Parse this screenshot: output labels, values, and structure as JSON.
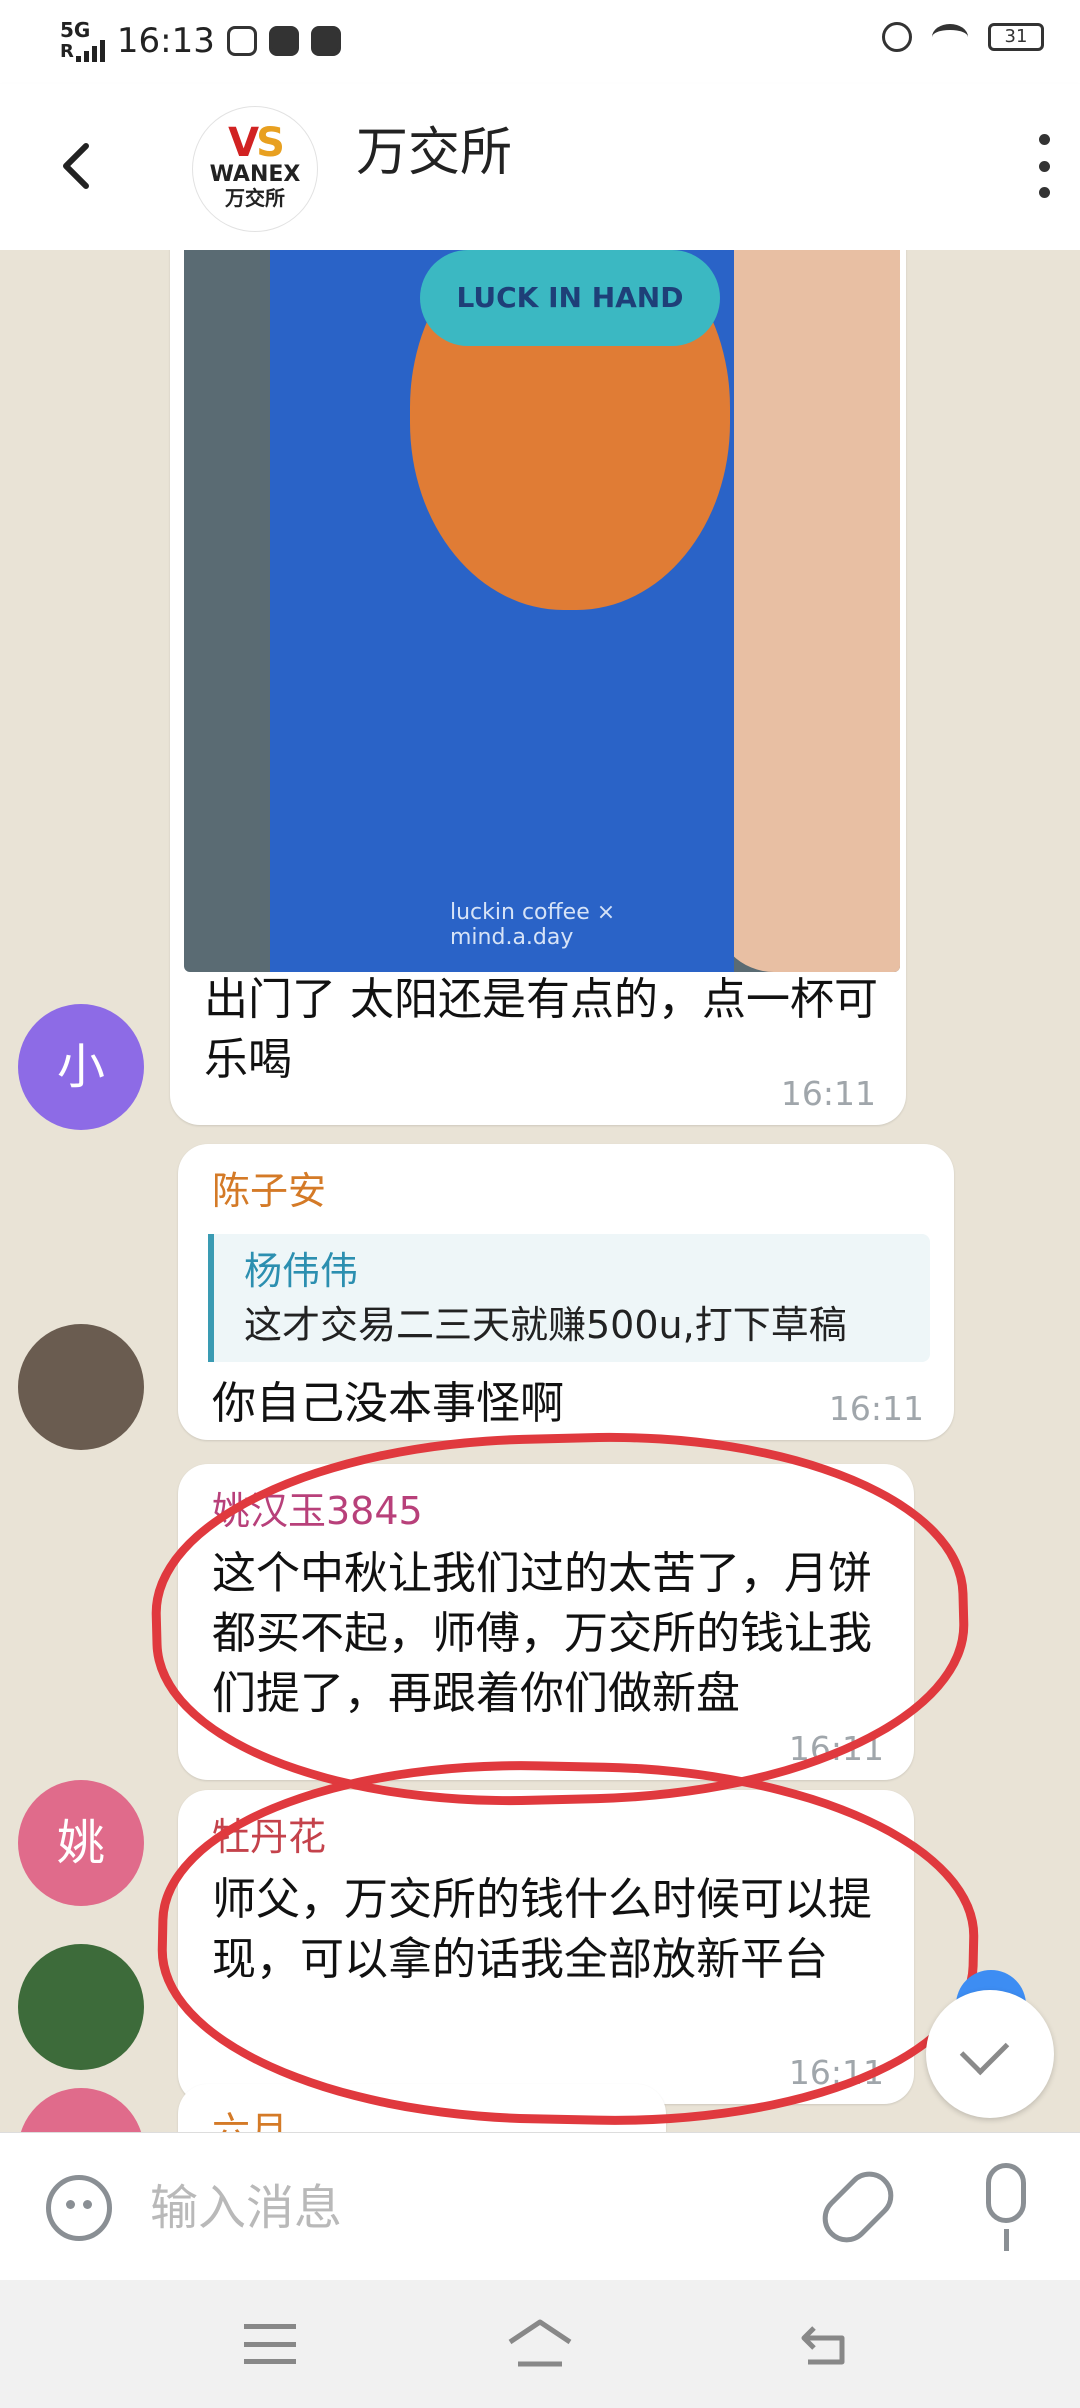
{
  "status_bar": {
    "network_label": "5G",
    "roaming": "R",
    "time": "16:13",
    "battery": "31"
  },
  "header": {
    "title": "万交所",
    "avatar": {
      "brand": "WANEX",
      "brand_cn": "万交所",
      "mark_v": "V",
      "mark_s": "S"
    }
  },
  "messages": [
    {
      "avatar_initial": "小",
      "image_caption": "luckin coffee × mind.a.day",
      "cap_text": "LUCK IN HAND",
      "text": "出门了 太阳还是有点的，点一杯可乐喝",
      "time": "16:11"
    },
    {
      "sender": "陈子安",
      "sender_color": "#d47a27",
      "reply_to": {
        "name": "杨伟伟",
        "text": "这才交易二三天就赚500u,打下草稿"
      },
      "text": "你自己没本事怪啊",
      "time": "16:11"
    },
    {
      "avatar_initial": "姚",
      "sender": "姚汉玉3845",
      "sender_color": "#b8407a",
      "text": "这个中秋让我们过的太苦了，月饼都买不起，师傅，万交所的钱让我们提了，再跟着你们做新盘",
      "time": "16:11"
    },
    {
      "sender": "牡丹花",
      "sender_color": "#c4424b",
      "text": "师父，万交所的钱什么时候可以提现，可以拿的话我全部放新平台",
      "time": "16:11"
    },
    {
      "sender": "六月",
      "sender_color": "#d47a27"
    }
  ],
  "input": {
    "placeholder": "输入消息"
  },
  "colors": {
    "accent": "#3d8df3",
    "annotation": "#e0393e",
    "chat_bg": "#e9e3d6"
  }
}
